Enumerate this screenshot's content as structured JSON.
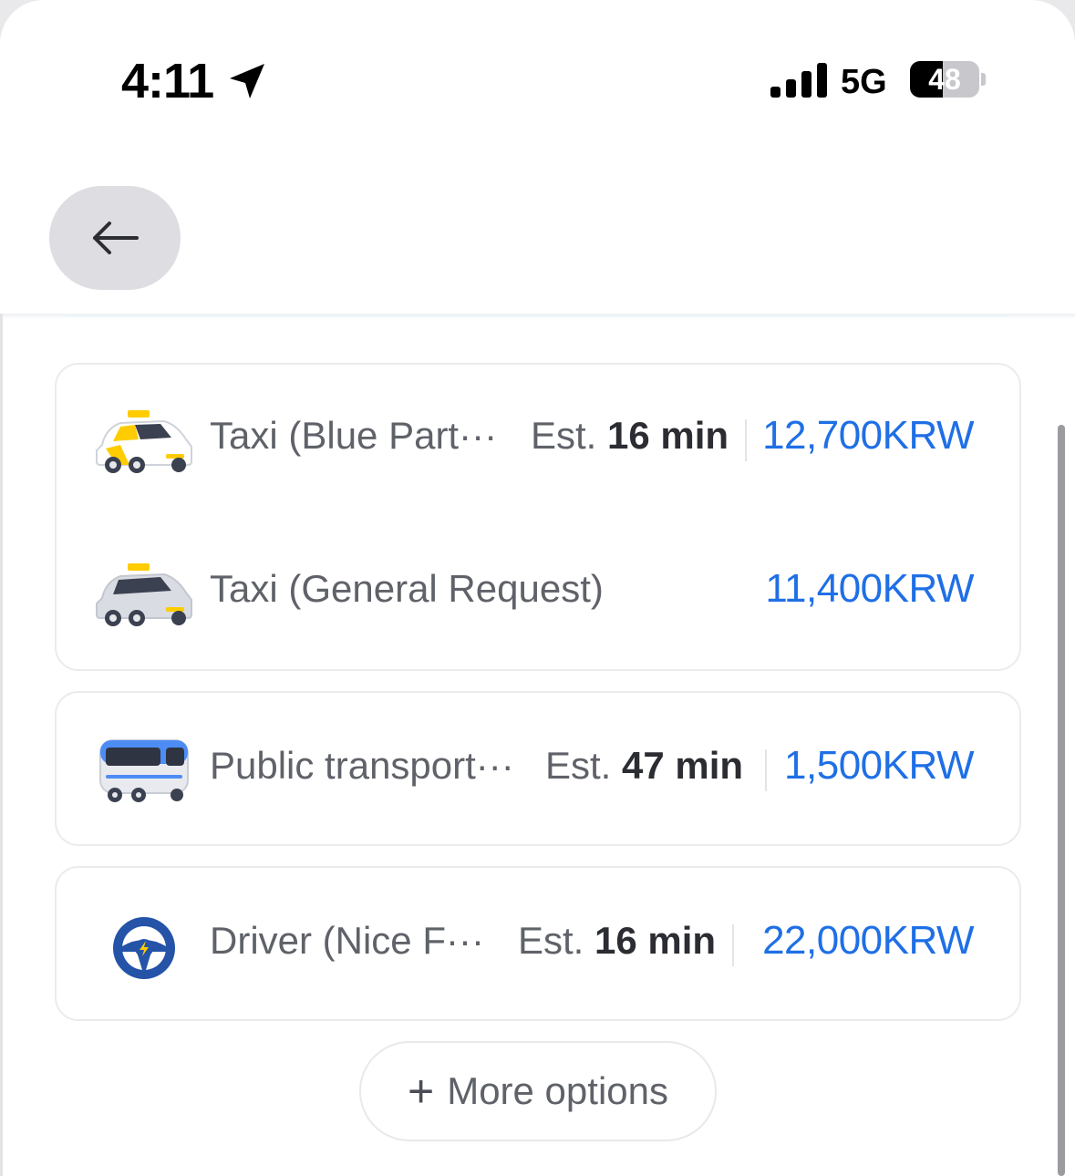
{
  "status_bar": {
    "time": "4:11",
    "network": "5G",
    "battery_level": "48",
    "battery_percent": 48
  },
  "nav": {
    "back_icon": "arrow-left-icon"
  },
  "options": [
    {
      "icon": "taxi-blue-icon",
      "name": "Taxi (Blue Part···",
      "eta_prefix": "Est.",
      "eta_value": "16 min",
      "price": "12,700KRW"
    },
    {
      "icon": "taxi-general-icon",
      "name": "Taxi (General Request)",
      "price": "11,400KRW"
    },
    {
      "icon": "bus-icon",
      "name": "Public transport···",
      "eta_prefix": "Est.",
      "eta_value": "47 min",
      "price": "1,500KRW"
    },
    {
      "icon": "steering-wheel-icon",
      "name": "Driver (Nice F···",
      "eta_prefix": "Est.",
      "eta_value": "16 min",
      "price": "22,000KRW"
    }
  ],
  "more_options": {
    "icon": "plus-icon",
    "label": "More options"
  },
  "colors": {
    "price": "#1f6fe6",
    "taxi_yellow": "#ffcc00",
    "bus_blue": "#4d8cf5",
    "driver_blue": "#2453a8"
  }
}
